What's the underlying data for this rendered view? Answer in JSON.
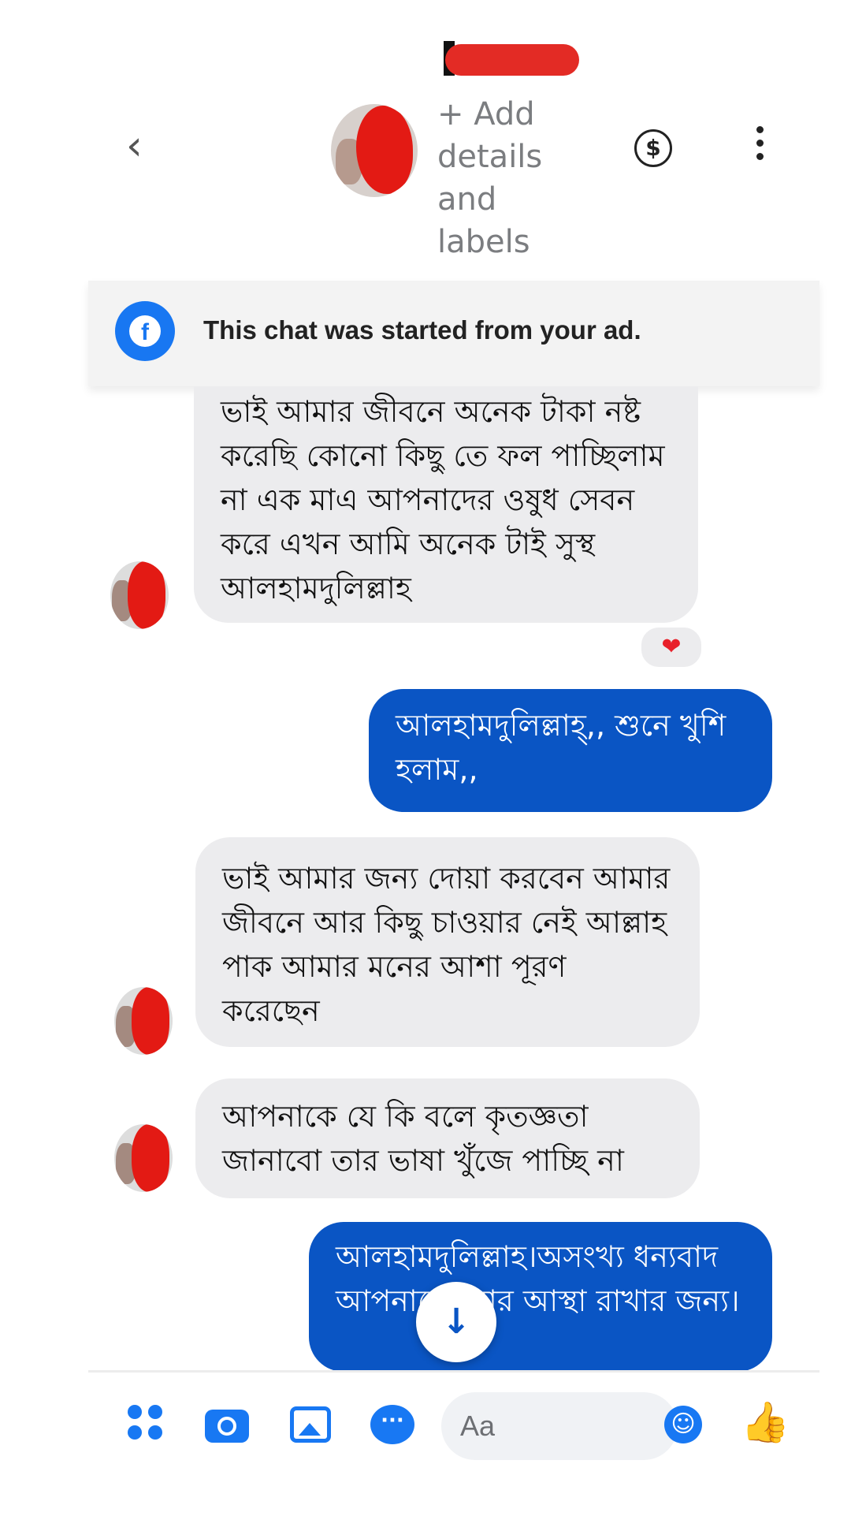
{
  "header": {
    "back_icon": "chevron-left-icon",
    "add_details_label": "+ Add details and labels",
    "payment_icon": "dollar-circle-icon",
    "more_icon": "vertical-dots-icon"
  },
  "banner": {
    "icon": "facebook-icon",
    "text": "This chat was started from your ad."
  },
  "messages": [
    {
      "sender": "contact",
      "text": "ভাই আমার জীবনে অনেক টাকা নষ্ট করেছি কোনো কিছু তে ফল পাচ্ছিলাম না এক মাএ আপনাদের ওষুধ সেবন করে এখন আমি অনেক টাই সুস্থ আলহামদুলিল্লাহ",
      "reaction": "❤"
    },
    {
      "sender": "me",
      "text": "আলহামদুলিল্লাহ্,, শুনে খুশি হলাম,,"
    },
    {
      "sender": "contact",
      "text": "ভাই আমার জন্য দোয়া করবেন আমার জীবনে আর কিছু চাওয়ার নেই আল্লাহ পাক আমার মনের আশা পূরণ করেছেন"
    },
    {
      "sender": "contact",
      "text": "আপনাকে যে কি বলে কৃতজ্ঞতা জানাবো তার ভাষা খুঁজে পাচ্ছি না"
    },
    {
      "sender": "me",
      "text": "আলহামদুলিল্লাহ।অসংখ্য ধন্যবাদ আপনাকে স্যার আস্থা রাখার জন্য।"
    }
  ],
  "scroll_down_icon": "arrow-down-icon",
  "composer": {
    "placeholder": "Aa",
    "icons": [
      "apps-icon",
      "camera-icon",
      "image-icon",
      "chat-bubble-icon",
      "emoji-icon",
      "thumbs-up-icon"
    ]
  },
  "colors": {
    "accent": "#1878f3",
    "outgoing_bubble": "#0a55c4",
    "incoming_bubble": "#ececee"
  }
}
